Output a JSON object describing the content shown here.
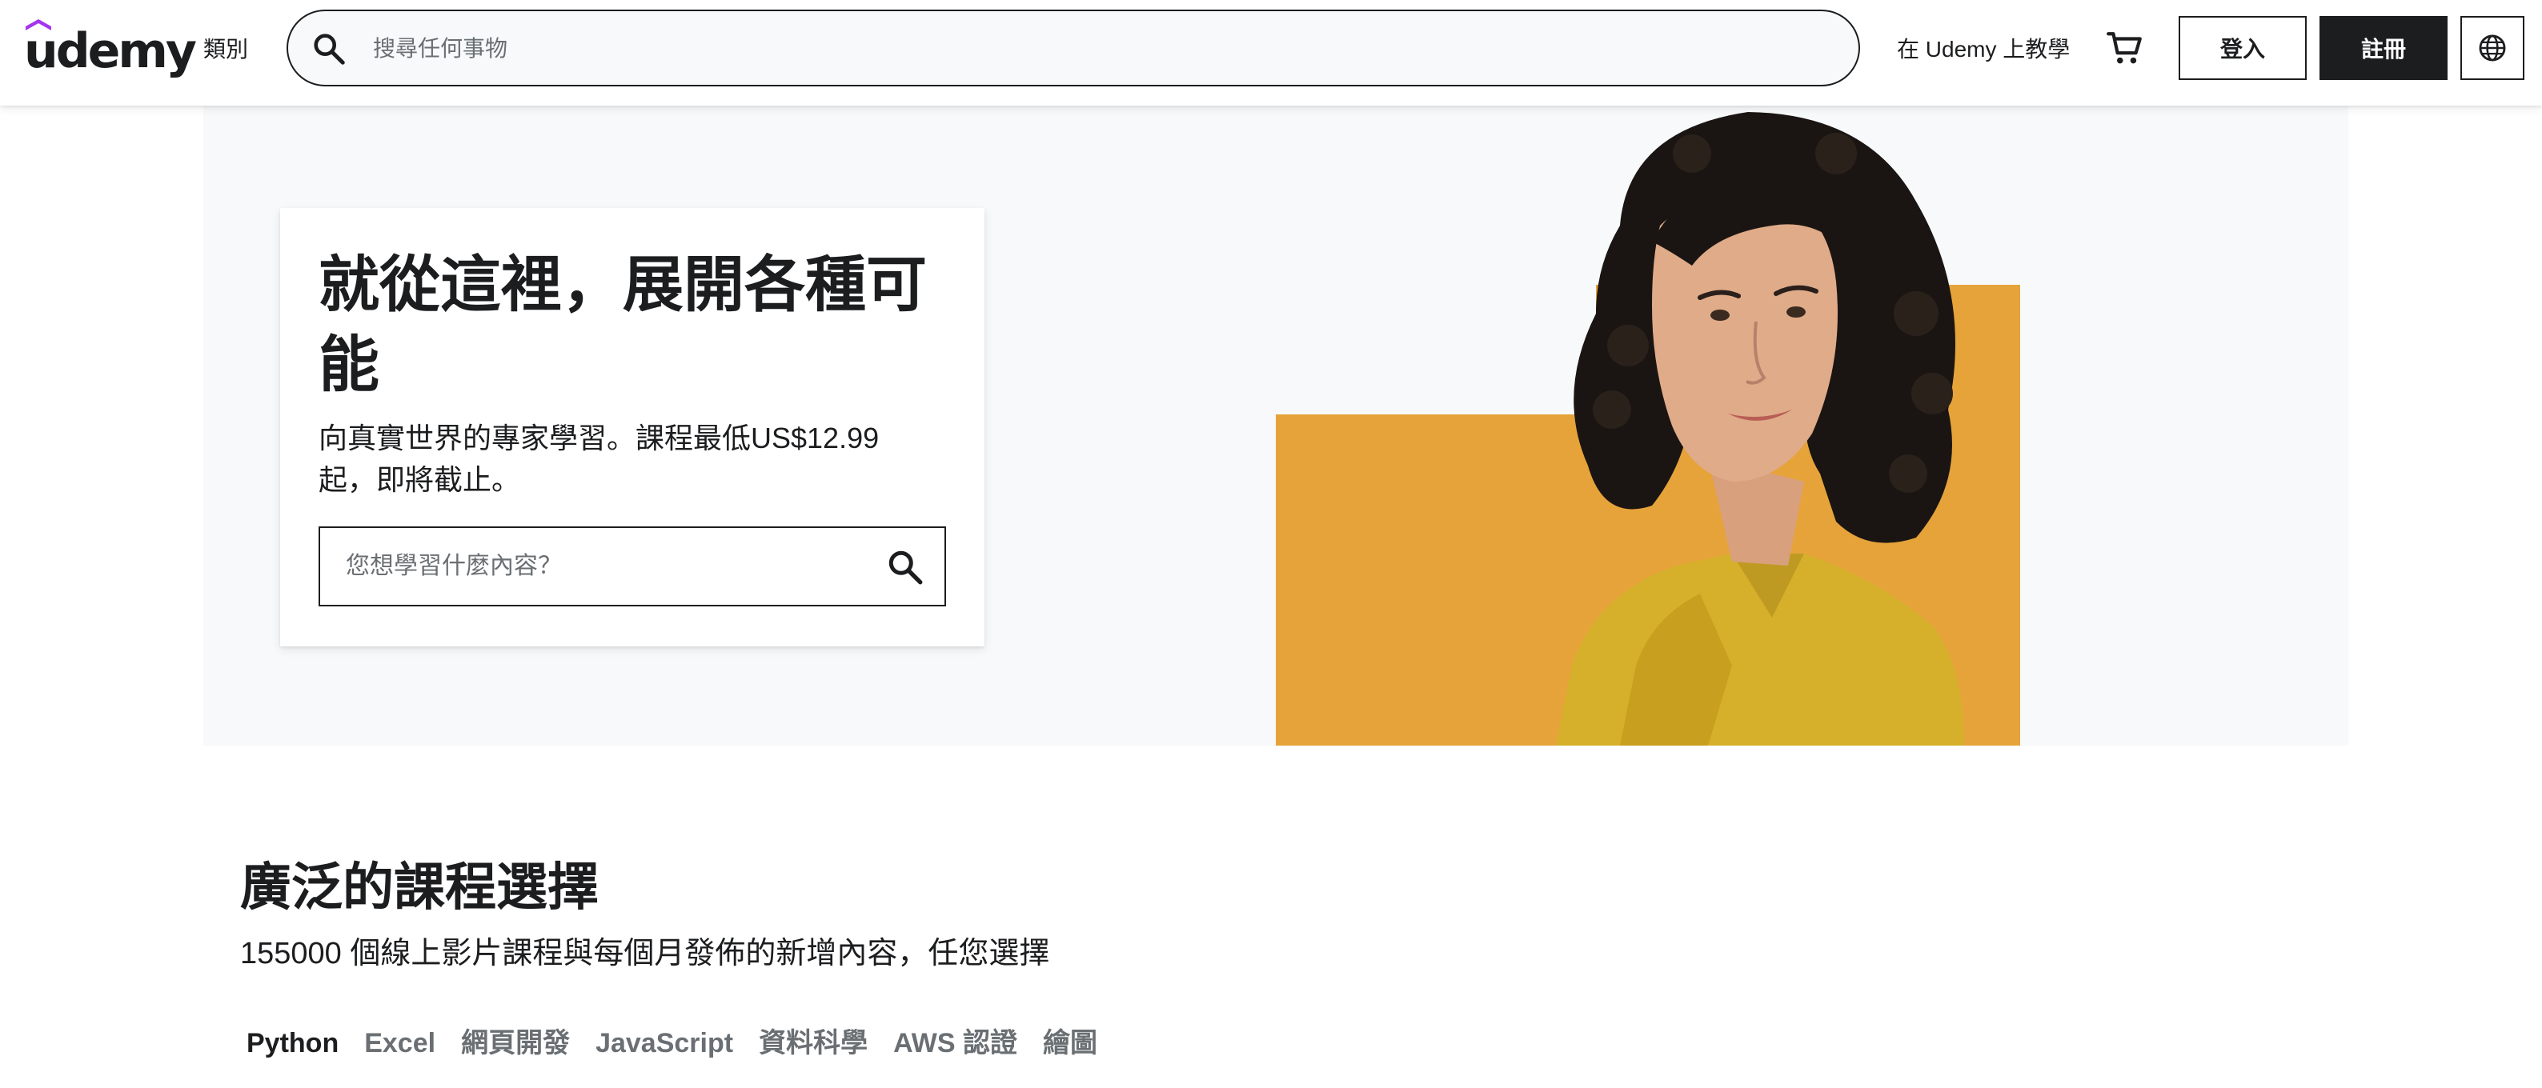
{
  "header": {
    "logo_text": "udemy",
    "categories_label": "類別",
    "search_placeholder": "搜尋任何事物",
    "teach_label": "在 Udemy 上教學",
    "login_label": "登入",
    "signup_label": "註冊"
  },
  "hero": {
    "title": "就從這裡，展開各種可能",
    "subtitle": "向真實世界的專家學習。課程最低US$12.99起，即將截止。",
    "search_placeholder": "您想學習什麼內容？"
  },
  "courses": {
    "title": "廣泛的課程選擇",
    "subtitle": "155000 個線上影片課程與每個月發佈的新增內容，任您選擇",
    "tabs": [
      {
        "label": "Python",
        "active": true
      },
      {
        "label": "Excel",
        "active": false
      },
      {
        "label": "網頁開發",
        "active": false
      },
      {
        "label": "JavaScript",
        "active": false
      },
      {
        "label": "資料科學",
        "active": false
      },
      {
        "label": "AWS 認證",
        "active": false
      },
      {
        "label": "繪圖",
        "active": false
      }
    ]
  },
  "icons": {
    "search": "search-icon",
    "cart": "cart-icon",
    "language": "globe-icon",
    "logo_mark": "udemy-hat-icon"
  },
  "colors": {
    "brand_purple": "#a435f0",
    "text_dark": "#1c1d1f",
    "hero_bg": "#f7f9fa",
    "hero_accent": "#e6a33a",
    "shirt": "#d6b02a"
  }
}
